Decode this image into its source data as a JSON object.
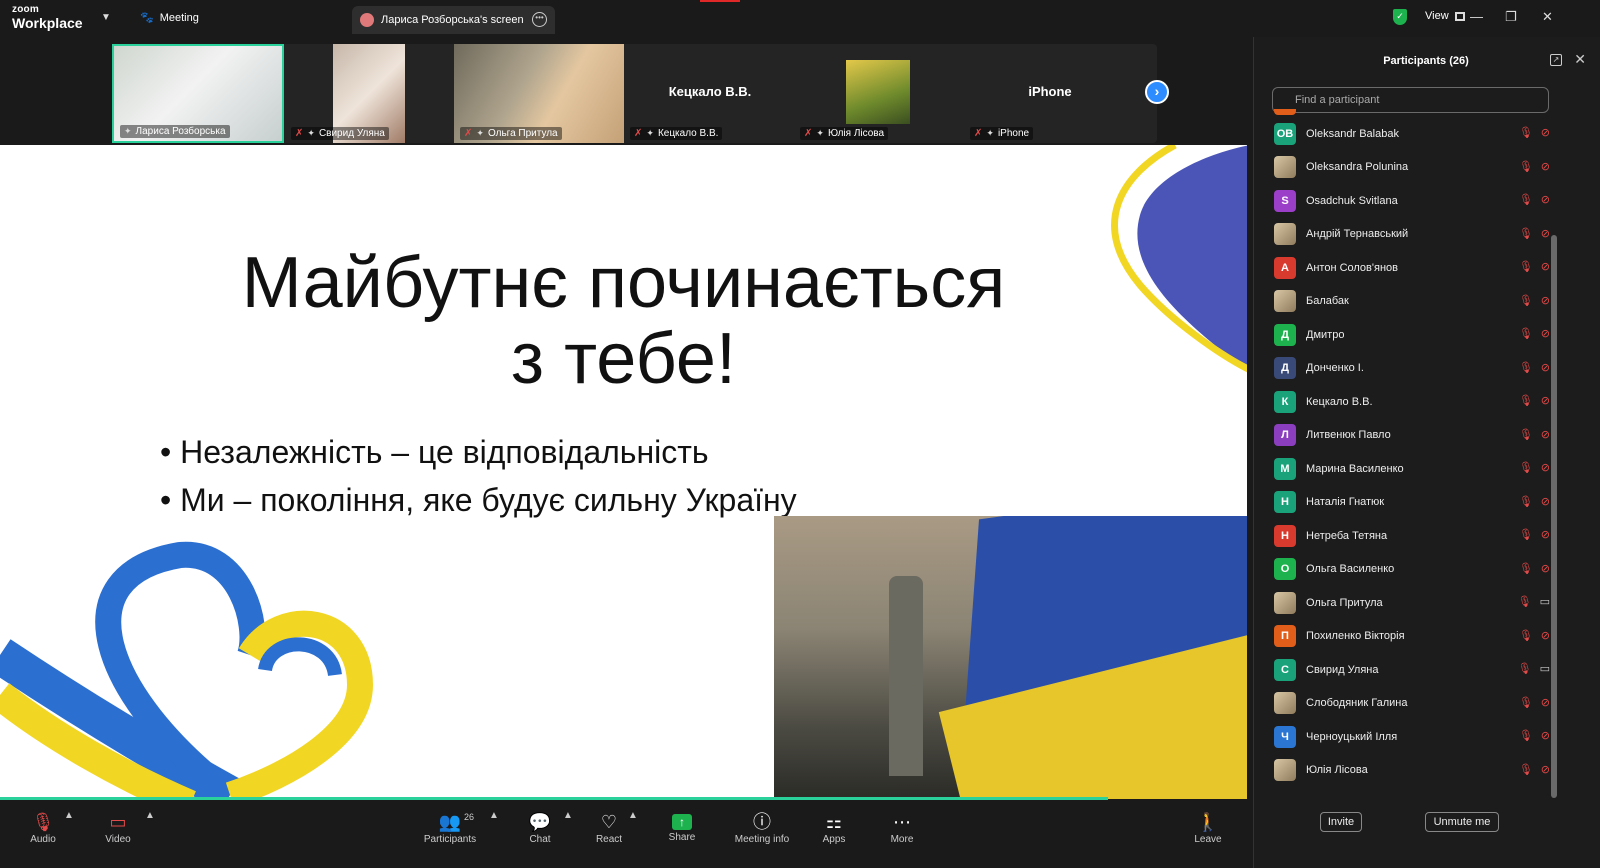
{
  "titlebar": {
    "logo_small": "zoom",
    "logo_big": "Workplace",
    "meeting_label": "Meeting",
    "screen_tab": "Лариса Розборська's screen",
    "view_label": "View"
  },
  "thumbs": [
    {
      "name": "Лариса Розборська"
    },
    {
      "name": "Свирид Уляна"
    },
    {
      "name": "Ольга Притула"
    },
    {
      "name": "Кецкало В.В.",
      "center": "Кецкало В.В."
    },
    {
      "name": "Юлія Лісова"
    },
    {
      "name": "iPhone",
      "center": "iPhone"
    }
  ],
  "slide": {
    "title_line1": "Майбутнє починається",
    "title_line2": "з тебе!",
    "bullets": [
      "Незалежність – це відповідальність",
      "Ми – покоління, яке будує сильну Україну"
    ]
  },
  "toolbar": {
    "audio": "Audio",
    "video": "Video",
    "participants": "Participants",
    "participants_count": "26",
    "chat": "Chat",
    "react": "React",
    "share": "Share",
    "meeting_info": "Meeting info",
    "apps": "Apps",
    "more": "More",
    "leave": "Leave"
  },
  "panel": {
    "title": "Participants (26)",
    "search_placeholder": "Find a participant",
    "invite": "Invite",
    "unmute": "Unmute me",
    "participants": [
      {
        "initials": "OB",
        "name": "Oleksandr Balabak",
        "color": "#1aa37a",
        "video_on": false
      },
      {
        "initials": "",
        "name": "Oleksandra Polunina",
        "color": "",
        "video_on": false
      },
      {
        "initials": "S",
        "name": "Osadchuk Svitlana",
        "color": "#9b3fc9",
        "video_on": false
      },
      {
        "initials": "",
        "name": "Андрій Тернавський",
        "color": "",
        "video_on": false
      },
      {
        "initials": "А",
        "name": "Антон Солов'янов",
        "color": "#d83a2e",
        "video_on": false
      },
      {
        "initials": "",
        "name": "Балабак",
        "color": "",
        "video_on": false
      },
      {
        "initials": "Д",
        "name": "Дмитро",
        "color": "#1eb24f",
        "video_on": false
      },
      {
        "initials": "Д",
        "name": "Донченко І.",
        "color": "#3a4a78",
        "video_on": false
      },
      {
        "initials": "К",
        "name": "Кецкало В.В.",
        "color": "#1aa37a",
        "video_on": false
      },
      {
        "initials": "Л",
        "name": "Литвенюк Павло",
        "color": "#8b3fbf",
        "video_on": false
      },
      {
        "initials": "М",
        "name": "Марина Василенко",
        "color": "#1aa37a",
        "video_on": false
      },
      {
        "initials": "Н",
        "name": "Наталія Гнатюк",
        "color": "#1aa37a",
        "video_on": false
      },
      {
        "initials": "Н",
        "name": "Нетреба Тетяна",
        "color": "#d83a2e",
        "video_on": false
      },
      {
        "initials": "О",
        "name": "Ольга Василенко",
        "color": "#1eb24f",
        "video_on": false
      },
      {
        "initials": "",
        "name": "Ольга Притула",
        "color": "",
        "video_on": true
      },
      {
        "initials": "П",
        "name": "Похиленко Вікторія",
        "color": "#e05d1a",
        "video_on": false
      },
      {
        "initials": "С",
        "name": "Свирид Уляна",
        "color": "#1aa37a",
        "video_on": true
      },
      {
        "initials": "",
        "name": "Слободяник Галина",
        "color": "",
        "video_on": false
      },
      {
        "initials": "Ч",
        "name": "Черноуцький Ілля",
        "color": "#2a76d2",
        "video_on": false
      },
      {
        "initials": "",
        "name": "Юлія Лісова",
        "color": "",
        "video_on": false
      }
    ]
  }
}
